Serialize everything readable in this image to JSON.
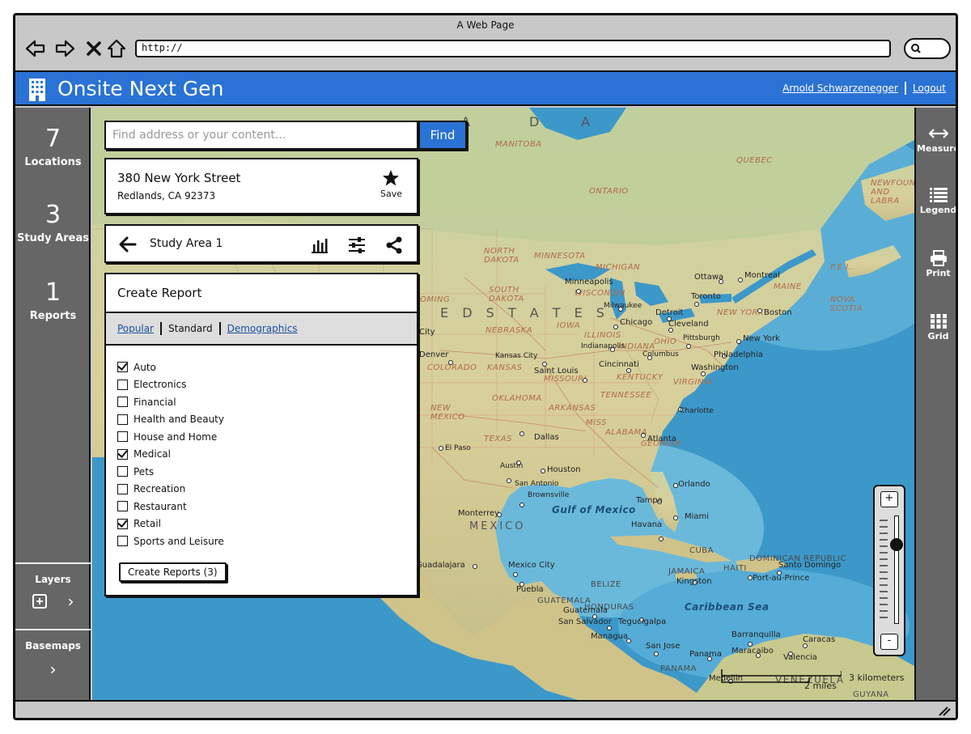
{
  "browser": {
    "window_title": "A Web Page",
    "url": "http://"
  },
  "app": {
    "title": "Onsite Next Gen",
    "user_name": "Arnold Schwarzenegger",
    "logout_label": "Logout",
    "brand_color": "#2a72d4"
  },
  "sidebar": {
    "stats": [
      {
        "value": "7",
        "label": "Locations"
      },
      {
        "value": "3",
        "label": "Study Areas"
      },
      {
        "value": "1",
        "label": "Reports"
      }
    ],
    "layers_label": "Layers",
    "basemaps_label": "Basemaps"
  },
  "toolbar": {
    "items": [
      {
        "label": "Measure",
        "icon": "measure-icon"
      },
      {
        "label": "Legend",
        "icon": "legend-icon"
      },
      {
        "label": "Print",
        "icon": "print-icon"
      },
      {
        "label": "Grid",
        "icon": "grid-icon"
      }
    ]
  },
  "search": {
    "placeholder": "Find address or your content...",
    "button_label": "Find"
  },
  "location": {
    "street": "380 New York Street",
    "city": "Redlands, CA 92373",
    "save_label": "Save"
  },
  "study_area": {
    "title": "Study Area 1"
  },
  "report": {
    "title": "Create Report",
    "tabs": [
      {
        "label": "Popular",
        "active": false
      },
      {
        "label": "Standard",
        "active": true
      },
      {
        "label": "Demographics",
        "active": false
      }
    ],
    "categories": [
      {
        "label": "Auto",
        "checked": true
      },
      {
        "label": "Electronics",
        "checked": false
      },
      {
        "label": "Financial",
        "checked": false
      },
      {
        "label": "Health and Beauty",
        "checked": false
      },
      {
        "label": "House and Home",
        "checked": false
      },
      {
        "label": "Medical",
        "checked": true
      },
      {
        "label": "Pets",
        "checked": false
      },
      {
        "label": "Recreation",
        "checked": false
      },
      {
        "label": "Restaurant",
        "checked": false
      },
      {
        "label": "Retail",
        "checked": true
      },
      {
        "label": "Sports and Leisure",
        "checked": false
      }
    ],
    "button_label": "Create Reports (3)"
  },
  "zoom": {
    "plus": "+",
    "minus": "-",
    "level": 0.27
  },
  "map": {
    "scale_km": "3 kilometers",
    "scale_mi": "2 miles",
    "big_labels": [
      "A",
      "D",
      "A",
      "E D   S T A T E S",
      "MEXICO"
    ],
    "regions": [
      "MANITOBA",
      "QUEBEC",
      "ONTARIO",
      "NEWFOUNDLAND AND LABRA",
      "NORTH DAKOTA",
      "MINNESOTA",
      "SOUTH DAKOTA",
      "WISCONSIN",
      "MICHIGAN",
      "NEBRASKA",
      "IOWA",
      "ILLINOIS",
      "INDIANA",
      "OHIO",
      "NEW YORK",
      "MAINE",
      "NOVA SCOTIA",
      "P.E.I.",
      "KANSAS",
      "MISSOURI",
      "KENTUCKY",
      "VIRGINIA",
      "OKLAHOMA",
      "ARKANSAS",
      "TENNESSEE",
      "COLORADO",
      "NEW MEXICO",
      "TEXAS",
      "MISS",
      "ALABAMA",
      "GEORGIA",
      "CUBA",
      "JAMAICA",
      "HAITI",
      "DOMINICAN REPUBLIC",
      "BELIZE",
      "GUATEMALA",
      "HONDURAS",
      "PANAMA",
      "VENEZUELA",
      "GUYANA",
      "OMING"
    ],
    "seas": [
      "Gulf of Mexico",
      "Caribbean Sea"
    ],
    "cities": [
      "Minneapolis",
      "Ottawa",
      "Montreal",
      "Toronto",
      "Milwaukee",
      "Detroit",
      "Boston",
      "Chicago",
      "Cleveland",
      "Pittsburgh",
      "New York",
      "Indianapolis",
      "Columbus",
      "Philadelphia",
      "Denver",
      "Kansas City",
      "Cincinnati",
      "Washington",
      "Saint Louis",
      "Charlotte",
      "Atlanta",
      "Dallas",
      "El Paso",
      "Austin",
      "Houston",
      "San Antonio",
      "Orlando",
      "Tampa",
      "Miami",
      "Monterrey",
      "Brownsville",
      "Havana",
      "Guadalajara",
      "Mexico City",
      "Puebla",
      "Kingston",
      "Santo Domingo",
      "Port-au-Prince",
      "Guatemala",
      "San Salvador",
      "Tegucigalpa",
      "Managua",
      "San Jose",
      "Panama",
      "Barranquilla",
      "Maracaibo",
      "Caracas",
      "Valencia",
      "Medellin",
      "City"
    ]
  }
}
